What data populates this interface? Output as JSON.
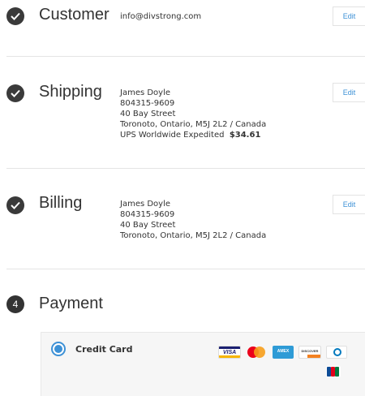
{
  "customer": {
    "title": "Customer",
    "email": "info@divstrong.com",
    "edit_label": "Edit"
  },
  "shipping": {
    "title": "Shipping",
    "name": "James Doyle",
    "phone": "804315-9609",
    "street": "40 Bay Street",
    "city_line": "Toronoto, Ontario, M5J 2L2 / Canada",
    "method": "UPS Worldwide Expedited",
    "price": "$34.61",
    "edit_label": "Edit"
  },
  "billing": {
    "title": "Billing",
    "name": "James Doyle",
    "phone": "804315-9609",
    "street": "40 Bay Street",
    "city_line": "Toronoto, Ontario, M5J 2L2 / Canada",
    "edit_label": "Edit"
  },
  "payment": {
    "step_number": "4",
    "title": "Payment",
    "option_label": "Credit Card",
    "card_visa": "VISA",
    "card_amex": "AMEX",
    "card_discover": "DISCOVER",
    "cards": [
      "visa-icon",
      "mastercard-icon",
      "amex-icon",
      "discover-icon",
      "diners-club-icon",
      "jcb-icon"
    ]
  },
  "colors": {
    "accent": "#3d91d6",
    "step_badge": "#333333",
    "panel_bg": "#f6f6f6"
  }
}
